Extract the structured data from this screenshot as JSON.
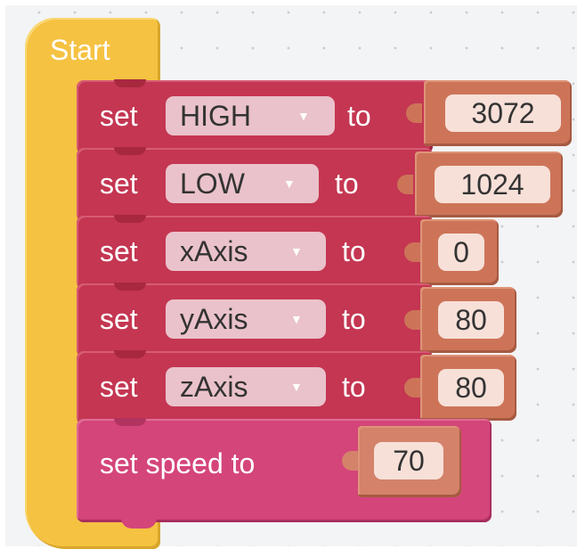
{
  "start_block": {
    "label": "Start"
  },
  "assignments": [
    {
      "set_label": "set",
      "variable": "HIGH",
      "to_label": "to",
      "value": "3072"
    },
    {
      "set_label": "set",
      "variable": "LOW",
      "to_label": "to",
      "value": "1024"
    },
    {
      "set_label": "set",
      "variable": "xAxis",
      "to_label": "to",
      "value": "0"
    },
    {
      "set_label": "set",
      "variable": "yAxis",
      "to_label": "to",
      "value": "80"
    },
    {
      "set_label": "set",
      "variable": "zAxis",
      "to_label": "to",
      "value": "80"
    }
  ],
  "speed_block": {
    "label": "set speed to",
    "value": "70"
  },
  "dropdown_icon": "chevron-down-icon",
  "colors": {
    "start_block": "#f5c242",
    "variable_block": "#c43652",
    "speed_block": "#d4457a",
    "value_block": "#cd7458",
    "value_field": "#f7e0d8",
    "dropdown_field": "#eac2cb"
  }
}
